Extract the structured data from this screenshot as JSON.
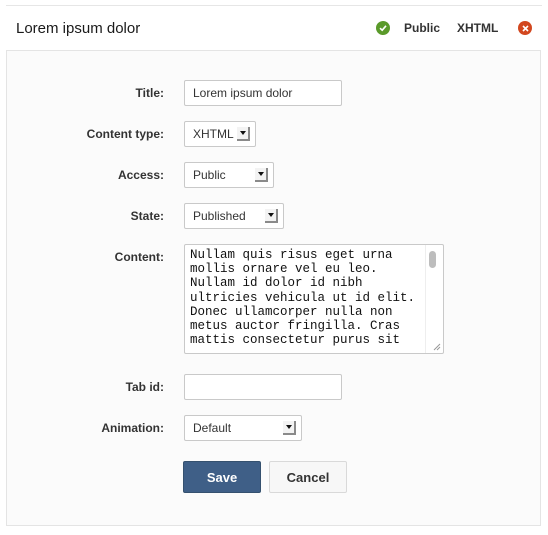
{
  "header": {
    "title": "Lorem ipsum dolor",
    "status_icon": "check-circle-icon",
    "access_label": "Public",
    "content_type_label": "XHTML",
    "close_icon": "close-circle-icon",
    "colors": {
      "status": "#5a9a2a",
      "close": "#d2471f"
    }
  },
  "form": {
    "title": {
      "label": "Title:",
      "value": "Lorem ipsum dolor"
    },
    "content_type": {
      "label": "Content type:",
      "value": "XHTML"
    },
    "access": {
      "label": "Access:",
      "value": "Public"
    },
    "state": {
      "label": "State:",
      "value": "Published"
    },
    "content": {
      "label": "Content:",
      "value": "Nullam quis risus eget urna mollis ornare vel eu leo. Nullam id dolor id nibh ultricies vehicula ut id elit. Donec ullamcorper nulla non metus auctor fringilla. Cras mattis consectetur purus sit"
    },
    "tab_id": {
      "label": "Tab id:",
      "value": ""
    },
    "animation": {
      "label": "Animation:",
      "value": "Default"
    }
  },
  "actions": {
    "save_label": "Save",
    "cancel_label": "Cancel",
    "save_color": "#3f5f87"
  }
}
